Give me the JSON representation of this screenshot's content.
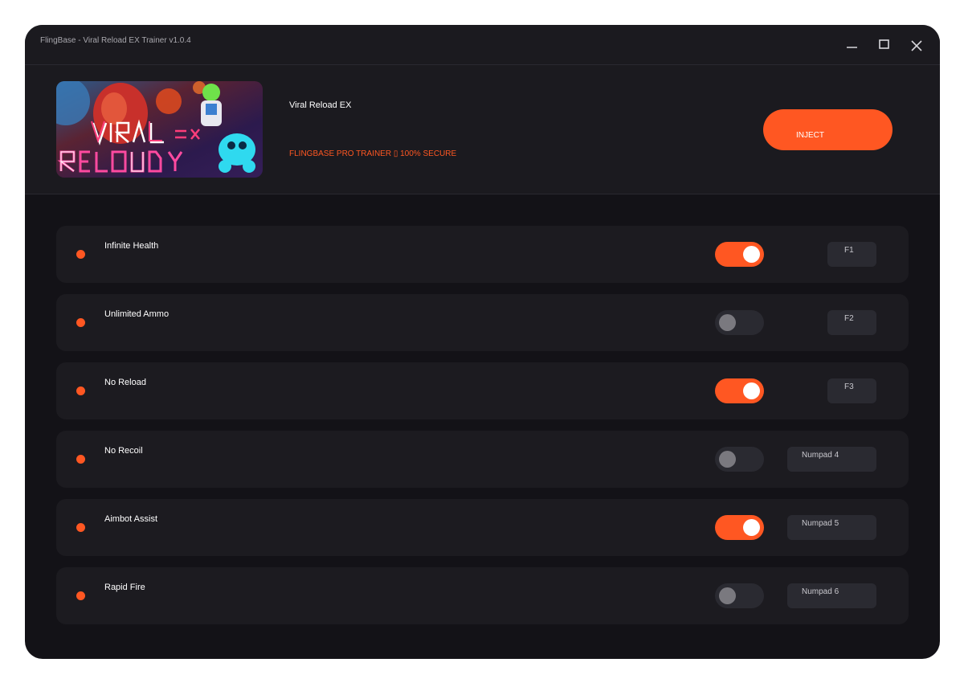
{
  "window": {
    "title": "FlingBase - Viral Reload EX Trainer v1.0.4",
    "controls": [
      "minimize-icon",
      "maximize-icon",
      "close-icon"
    ]
  },
  "header": {
    "cover_image": "game-cover-art",
    "cover_title": "VIRAL RELOAD EX",
    "game_name": "Viral Reload EX",
    "tagline": "FLINGBASE PRO TRAINER ▯ 100% SECURE",
    "inject_label": "INJECT"
  },
  "cheats": [
    {
      "label": "Infinite Health",
      "enabled": true,
      "hotkey": "F1"
    },
    {
      "label": "Unlimited Ammo",
      "enabled": false,
      "hotkey": "F2"
    },
    {
      "label": "No Reload",
      "enabled": true,
      "hotkey": "F3"
    },
    {
      "label": "No Recoil",
      "enabled": false,
      "hotkey": "Numpad 4"
    },
    {
      "label": "Aimbot Assist",
      "enabled": true,
      "hotkey": "Numpad 5"
    },
    {
      "label": "Rapid Fire",
      "enabled": false,
      "hotkey": "Numpad 6"
    }
  ],
  "colors": {
    "accent": "#ff5722",
    "background": "#131217",
    "panel": "#1b1a1f",
    "row": "#1c1b20",
    "toggle_off": "#2a2a31"
  }
}
